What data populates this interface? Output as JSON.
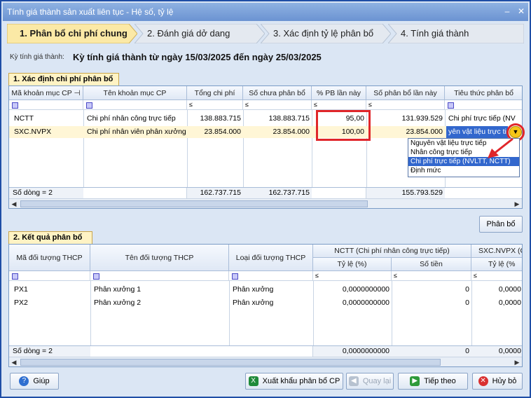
{
  "window": {
    "title": "Tính giá thành sản xuất liên tục - Hệ số, tỷ lệ"
  },
  "steps": [
    {
      "label": "1. Phân bổ chi phí chung",
      "active": true
    },
    {
      "label": "2. Đánh giá dở dang",
      "active": false
    },
    {
      "label": "3. Xác định tỷ lệ phân bổ",
      "active": false
    },
    {
      "label": "4. Tính giá thành",
      "active": false
    }
  ],
  "period": {
    "label": "Kỳ tính giá thành:",
    "value": "Kỳ tính giá thành từ ngày 15/03/2025 đến ngày 25/03/2025"
  },
  "section1": {
    "title": "1. Xác định chi phí phân bổ",
    "columns": [
      "Mã khoản mục CP",
      "Tên khoản mục CP",
      "Tổng chi phí",
      "Số chưa phân bổ",
      "% PB lần này",
      "Số phân bổ lần này",
      "Tiêu thức phân bổ"
    ],
    "filter_op": "≤",
    "rows": [
      {
        "code": "NCTT",
        "name": "Chi phí nhân công trực tiếp",
        "total": "138.883.715",
        "unallocated": "138.883.715",
        "pct": "95,00",
        "allocated": "131.939.529",
        "basis": "Chi phí trực tiếp (NV"
      },
      {
        "code": "SXC.NVPX",
        "name": "Chi phí nhân viên phân xưởng",
        "total": "23.854.000",
        "unallocated": "23.854.000",
        "pct": "100,00",
        "allocated": "23.854.000",
        "basis": "yên vật liệu trực tiế"
      }
    ],
    "footer": {
      "count": "Số dòng = 2",
      "total": "162.737.715",
      "unallocated": "162.737.715",
      "allocated": "155.793.529"
    },
    "dropdown_options": [
      "Nguyên vật liệu trực tiếp",
      "Nhân công trực tiếp",
      "Chi phí trực tiếp (NVLTT, NCTT)",
      "Định mức"
    ],
    "dropdown_selected_index": 2
  },
  "allocate_button": "Phân bổ",
  "section2": {
    "title": "2. Kết quả phân bổ",
    "columns": [
      "Mã đối tượng THCP",
      "Tên đối tượng THCP",
      "Loại đối tượng THCP"
    ],
    "group1": "NCTT (Chi phí nhân công trực tiếp)",
    "group2": "SXC.NVPX (C",
    "subcols": [
      "Tỷ lệ (%)",
      "Số tiền",
      "Tỷ lệ (%"
    ],
    "filter_op": "≤",
    "rows": [
      {
        "code": "PX1",
        "name": "Phân xưởng 1",
        "type": "Phân xưởng",
        "rate": "0,0000000000",
        "amount": "0",
        "rate2": "0,0000"
      },
      {
        "code": "PX2",
        "name": "Phân xưởng 2",
        "type": "Phân xưởng",
        "rate": "0,0000000000",
        "amount": "0",
        "rate2": "0,0000"
      }
    ],
    "footer": {
      "count": "Số dòng = 2",
      "rate": "0,0000000000",
      "amount": "0",
      "rate2": "0,0000"
    }
  },
  "buttons": {
    "help": "Giúp",
    "export": "Xuất khẩu phân bổ CP",
    "back": "Quay lại",
    "next": "Tiếp theo",
    "cancel": "Hủy bỏ"
  }
}
